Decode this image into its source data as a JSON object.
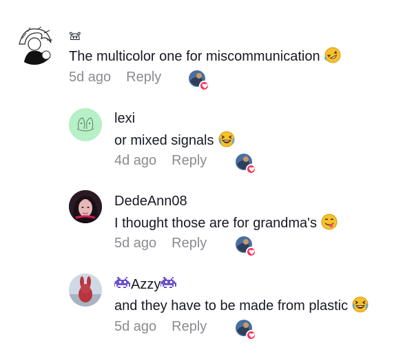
{
  "comments": [
    {
      "username": "𖠌",
      "text": "The multicolor one for miscommunication",
      "time": "5d ago",
      "reply_label": "Reply",
      "emoji": "rolling-on-floor-laughing-emoji"
    },
    {
      "username": "lexi",
      "text": "or mixed signals",
      "time": "4d ago",
      "reply_label": "Reply",
      "emoji": "grinning-squinting-emoji"
    },
    {
      "username": "DedeAnn08",
      "text": "I thought those are for grandma's",
      "time": "5d ago",
      "reply_label": "Reply",
      "emoji": "face-savoring-food-emoji"
    },
    {
      "username": "Azzy",
      "username_decoration": "alien-monster-icon",
      "text": "and they have to be made from plastic",
      "time": "5d ago",
      "reply_label": "Reply",
      "emoji": "grinning-squinting-emoji"
    }
  ],
  "colors": {
    "text": "#161823",
    "muted": "#8a8b91",
    "heart": "#fe2c55",
    "emoji_yellow": "#f6c12b"
  }
}
